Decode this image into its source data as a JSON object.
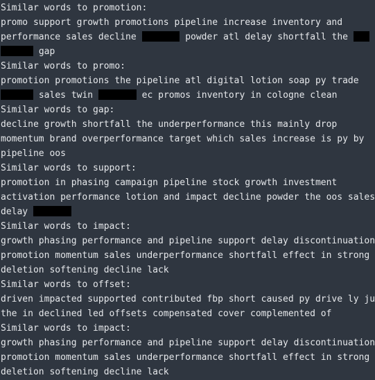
{
  "colors": {
    "background": "#2f3640",
    "text": "#e6e8eb",
    "redaction": "#000000"
  },
  "lines": [
    {
      "segments": [
        {
          "text": "Similar words to promotion:"
        }
      ]
    },
    {
      "segments": [
        {
          "text": "promo support growth promotions pipeline increase inventory and"
        }
      ]
    },
    {
      "segments": [
        {
          "text": "performance sales decline "
        },
        {
          "redact": 7
        },
        {
          "text": " powder atl delay shortfall the "
        },
        {
          "redact": 3
        }
      ]
    },
    {
      "segments": [
        {
          "redact": 6
        },
        {
          "text": " gap"
        }
      ]
    },
    {
      "segments": [
        {
          "text": "Similar words to promo:"
        }
      ]
    },
    {
      "segments": [
        {
          "text": "promotion promotions the pipeline atl digital lotion soap py trade"
        }
      ]
    },
    {
      "segments": [
        {
          "redact": 6
        },
        {
          "text": " sales twin "
        },
        {
          "redact": 7
        },
        {
          "text": " ec promos inventory in cologne clean"
        }
      ]
    },
    {
      "segments": [
        {
          "text": "Similar words to gap:"
        }
      ]
    },
    {
      "segments": [
        {
          "text": "decline growth shortfall the underperformance this mainly drop"
        }
      ]
    },
    {
      "segments": [
        {
          "text": "momentum brand overperformance target which sales increase is py by"
        }
      ]
    },
    {
      "segments": [
        {
          "text": "pipeline oos"
        }
      ]
    },
    {
      "segments": [
        {
          "text": "Similar words to support:"
        }
      ]
    },
    {
      "segments": [
        {
          "text": "promotion in phasing campaign pipeline stock growth investment"
        }
      ]
    },
    {
      "segments": [
        {
          "text": "activation performance lotion and impact decline powder the oos sales"
        }
      ]
    },
    {
      "segments": [
        {
          "text": "delay "
        },
        {
          "redact": 7
        }
      ]
    },
    {
      "segments": [
        {
          "text": "Similar words to impact:"
        }
      ]
    },
    {
      "segments": [
        {
          "text": "growth phasing performance and pipeline support delay discontinuation"
        }
      ]
    },
    {
      "segments": [
        {
          "text": "promotion momentum sales underperformance shortfall effect in strong"
        }
      ]
    },
    {
      "segments": [
        {
          "text": "deletion softening decline lack"
        }
      ]
    },
    {
      "segments": [
        {
          "text": "Similar words to offset:"
        }
      ]
    },
    {
      "segments": [
        {
          "text": "driven impacted supported contributed fbp short caused py drive ly ju"
        }
      ]
    },
    {
      "segments": [
        {
          "text": "the in declined led offsets compensated cover complemented of"
        }
      ]
    },
    {
      "segments": [
        {
          "text": "Similar words to impact:"
        }
      ]
    },
    {
      "segments": [
        {
          "text": "growth phasing performance and pipeline support delay discontinuation"
        }
      ]
    },
    {
      "segments": [
        {
          "text": "promotion momentum sales underperformance shortfall effect in strong"
        }
      ]
    },
    {
      "segments": [
        {
          "text": "deletion softening decline lack"
        }
      ]
    }
  ]
}
